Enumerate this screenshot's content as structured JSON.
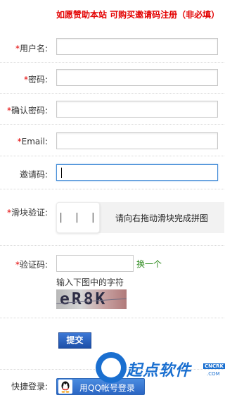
{
  "notice": "如愿赞助本站 可购买邀请码注册（非必填）",
  "form": {
    "required_mark": "*",
    "username_label": "用户名:",
    "password_label": "密码:",
    "confirm_password_label": "确认密码:",
    "email_label": "Email:",
    "invite_code_label": "邀请码:",
    "slider_label": "滑块验证:",
    "slider_knob_text": "| | |",
    "slider_hint": "请向右拖动滑块完成拼图",
    "captcha_label": "验证码:",
    "captcha_refresh": "换一个",
    "captcha_hint": "输入下图中的字符",
    "captcha_image_text": "eR8K",
    "submit_label": "提交"
  },
  "quick_login": {
    "label": "快捷登录:",
    "qq_button_label": "用QQ帐号登录"
  },
  "watermark": {
    "brand": "起点软件",
    "badge": "CNCRK",
    "domain": ".COM"
  },
  "colors": {
    "required": "#e30000",
    "link_green": "#2e8b1e",
    "button_blue": "#2b66c4",
    "focus_border": "#4a90d9"
  }
}
